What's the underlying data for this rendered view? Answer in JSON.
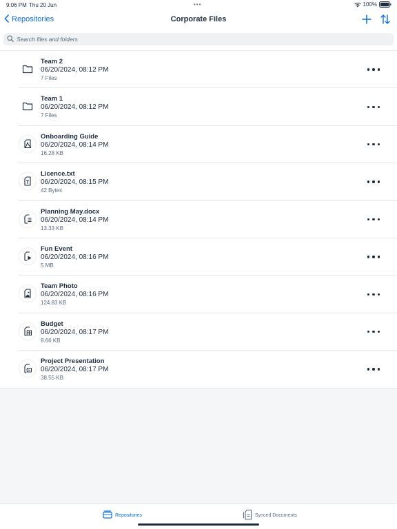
{
  "status_bar": {
    "time": "9:06 PM",
    "date": "Thu 20 Jun",
    "dots": "•••",
    "battery": "100%"
  },
  "nav": {
    "back_label": "Repositories",
    "title": "Corporate Files"
  },
  "search": {
    "placeholder": "Search files and folders",
    "value": ""
  },
  "items": [
    {
      "name": "Team 2",
      "date": "06/20/2024, 08:12 PM",
      "meta": "7 Files",
      "icon": "folder-icon"
    },
    {
      "name": "Team 1",
      "date": "06/20/2024, 08:12 PM",
      "meta": "7 Files",
      "icon": "folder-icon"
    },
    {
      "name": "Onboarding Guide",
      "date": "06/20/2024, 08:14 PM",
      "meta": "16.28 KB",
      "icon": "pdf-document-icon"
    },
    {
      "name": "Licence.txt",
      "date": "06/20/2024, 08:15 PM",
      "meta": "42 Bytes",
      "icon": "text-document-icon"
    },
    {
      "name": "Planning May.docx",
      "date": "06/20/2024, 08:14 PM",
      "meta": "13.33 KB",
      "icon": "word-document-icon"
    },
    {
      "name": "Fun Event",
      "date": "06/20/2024, 08:16 PM",
      "meta": "5 MB",
      "icon": "video-document-icon"
    },
    {
      "name": "Team Photo",
      "date": "06/20/2024, 08:16 PM",
      "meta": "124.83 KB",
      "icon": "image-document-icon"
    },
    {
      "name": "Budget",
      "date": "06/20/2024, 08:17 PM",
      "meta": "8.66 KB",
      "icon": "spreadsheet-document-icon"
    },
    {
      "name": "Project Presentation",
      "date": "06/20/2024, 08:17 PM",
      "meta": "38.55 KB",
      "icon": "presentation-document-icon"
    }
  ],
  "tabs": [
    {
      "label": "Repositories",
      "icon": "repository-icon",
      "active": true
    },
    {
      "label": "Synced Documents",
      "icon": "synced-documents-icon",
      "active": false
    }
  ],
  "colors": {
    "accent": "#0a6ed1",
    "text": "#1d2d3e",
    "secondary_text": "#556b82",
    "background": "#f5f6f7"
  }
}
